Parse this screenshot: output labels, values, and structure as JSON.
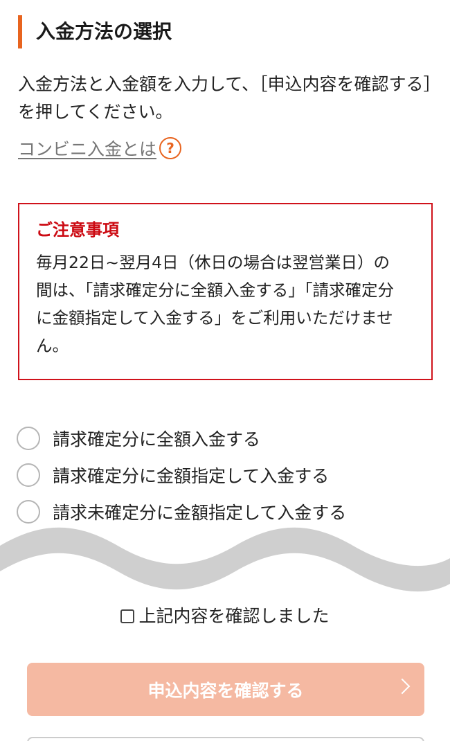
{
  "page": {
    "title": "入金方法の選択",
    "intro": "入金方法と入金額を入力して、［申込内容を確認する］を押してください。",
    "help_link": "コンビニ入金とは",
    "help_icon": "?"
  },
  "notice": {
    "title": "ご注意事項",
    "body": "毎月22日~翌月4日（休日の場合は翌営業日）の間は、「請求確定分に全額入金する」「請求確定分に金額指定して入金する」をご利用いただけません。"
  },
  "options": [
    {
      "label": "請求確定分に全額入金する"
    },
    {
      "label": "請求確定分に金額指定して入金する"
    },
    {
      "label": "請求未確定分に金額指定して入金する"
    }
  ],
  "confirm": {
    "label": "上記内容を確認しました"
  },
  "submit": {
    "label": "申込内容を確認する"
  },
  "colors": {
    "accent": "#e8641f",
    "notice_red": "#d0121b",
    "button_disabled": "#f5b9a2",
    "wave_gray": "#cfcfcf"
  }
}
